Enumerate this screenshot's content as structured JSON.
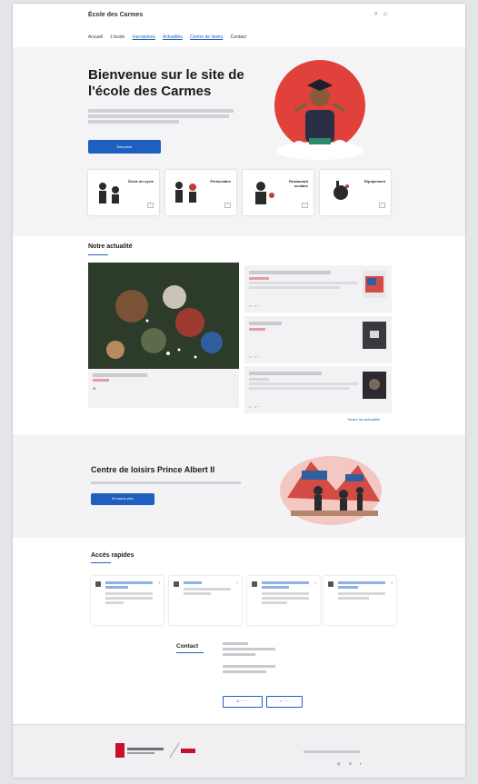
{
  "header": {
    "site_name": "École des Carmes",
    "icons": [
      "search-icon",
      "user-icon"
    ]
  },
  "nav": [
    "Accueil",
    "L'école",
    "Inscriptions",
    "Actualités",
    "Centre de loisirs",
    "Contact"
  ],
  "hero": {
    "title": "Bienvenue sur le site de l'école des Carmes",
    "button_label": "Découvrir"
  },
  "cards": [
    {
      "label": "École du cycle"
    },
    {
      "label": "Périscolaire"
    },
    {
      "label": "Restaurant scolaire"
    },
    {
      "label": "Équipement"
    }
  ],
  "news": {
    "title": "Notre actualité",
    "more_label": "Toutes les actualités"
  },
  "centre": {
    "title": "Centre de loisirs Prince Albert II",
    "button_label": "En savoir plus"
  },
  "quick": {
    "title": "Accès rapides"
  },
  "contact": {
    "title": "Contact"
  },
  "colors": {
    "accent": "#1f5fbf",
    "red": "#c8102e"
  }
}
